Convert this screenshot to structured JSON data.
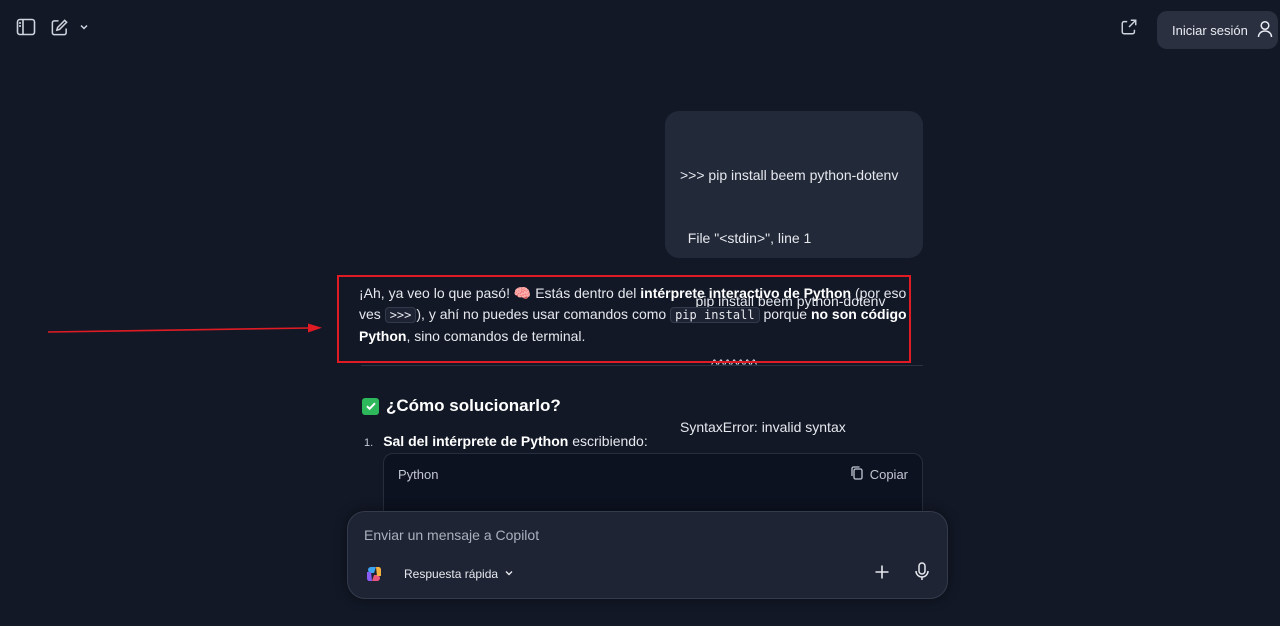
{
  "topbar": {
    "signin_label": "Iniciar sesión",
    "icons": [
      "sidebar-toggle-icon",
      "new-chat-icon",
      "chevron-down-icon",
      "share-icon",
      "user-icon"
    ]
  },
  "user_message": {
    "lines": [
      ">>> pip install beem python-dotenv",
      "  File \"<stdin>\", line 1",
      "    pip install beem python-dotenv",
      "        ^^^^^^^",
      "SyntaxError: invalid syntax",
      ">>>"
    ]
  },
  "answer": {
    "p1": "¡Ah, ya veo lo que pasó! ",
    "emoji": "🧠",
    "p2": " Estás dentro del ",
    "b1": "intérprete interactivo de Python",
    "p3": " (por eso ves ",
    "code1": ">>>",
    "p4": "), y ahí no puedes usar comandos como ",
    "code2": "pip install",
    "p5": " porque ",
    "b2": "no son código Python",
    "p6": ", sino comandos de terminal."
  },
  "section": {
    "heading": "¿Cómo solucionarlo?",
    "step_number": "1.",
    "step_bold": "Sal del intérprete de Python",
    "step_rest": " escribiendo:"
  },
  "code_block": {
    "language": "Python",
    "copy_label": "Copiar"
  },
  "composer": {
    "placeholder": "Enviar un mensaje a Copilot",
    "mode_label": "Respuesta rápida"
  },
  "colors": {
    "background": "#121826",
    "highlight_border": "#e01b24",
    "check_green": "#2eb85c"
  }
}
